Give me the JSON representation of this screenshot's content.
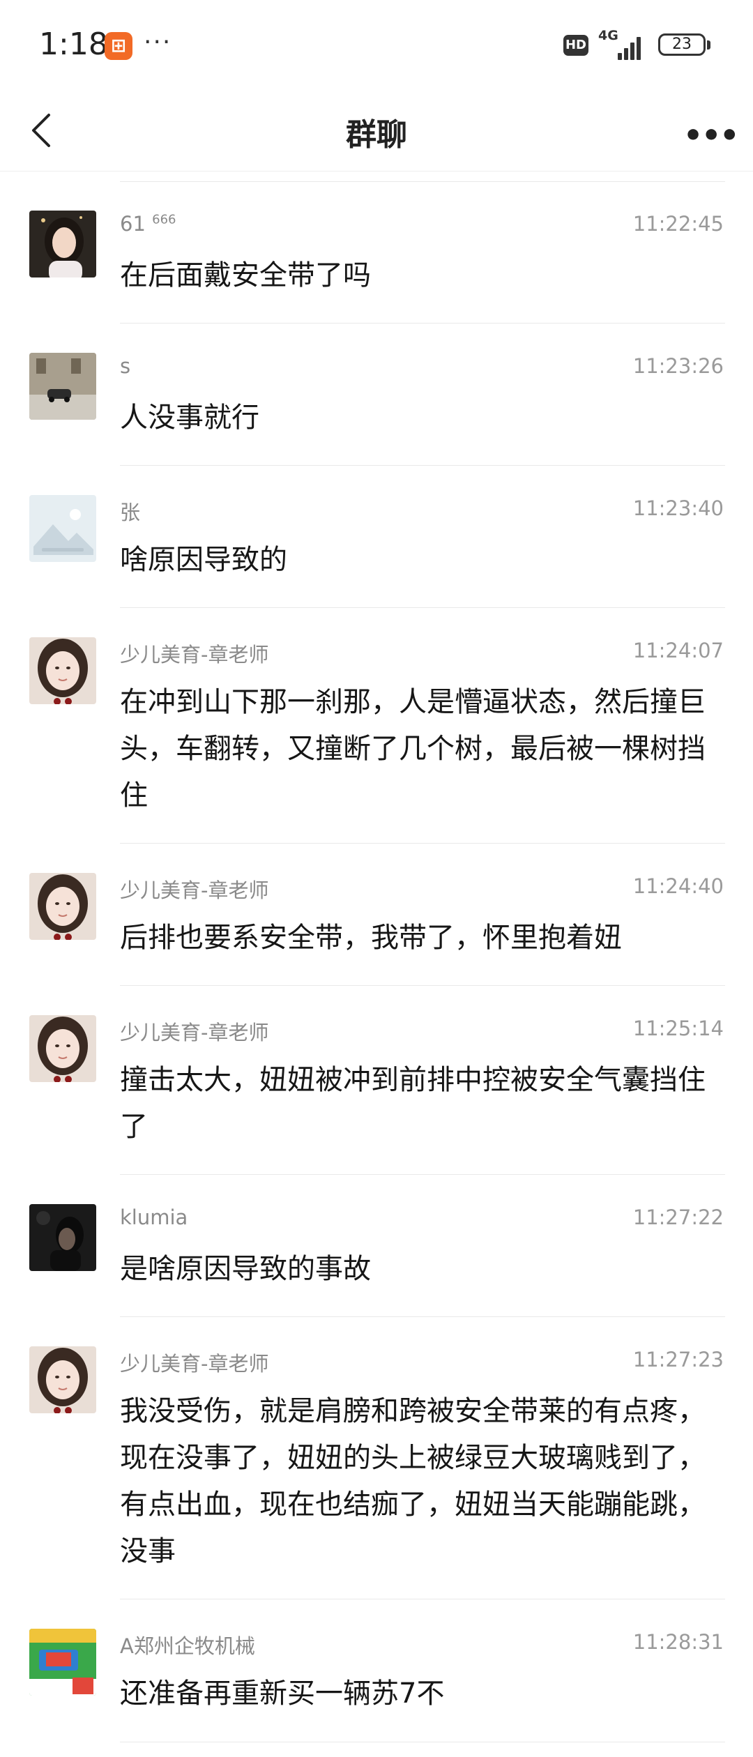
{
  "status_bar": {
    "time": "1:18",
    "app_icon": "app-badge-icon",
    "more": "···",
    "hd": "HD",
    "network": "4G",
    "battery": "23"
  },
  "header": {
    "title": "群聊",
    "back_icon": "back-chevron-icon",
    "more_icon": "more-dots-icon",
    "more_label": "•••"
  },
  "messages": [
    {
      "name": "61",
      "name_sup": "666",
      "time": "11:22:45",
      "text": "在后面戴安全带了吗",
      "avatar": "avatar-woman-portrait"
    },
    {
      "name": "s",
      "name_sup": "",
      "time": "11:23:26",
      "text": "人没事就行",
      "avatar": "avatar-car-street"
    },
    {
      "name": "张",
      "name_sup": "",
      "time": "11:23:40",
      "text": "啥原因导致的",
      "avatar": "avatar-placeholder-image"
    },
    {
      "name": "少儿美育-章老师",
      "name_sup": "",
      "time": "11:24:07",
      "text": "在冲到山下那一刹那，人是懵逼状态，然后撞巨头，车翻转，又撞断了几个树，最后被一棵树挡住",
      "avatar": "avatar-teacher"
    },
    {
      "name": "少儿美育-章老师",
      "name_sup": "",
      "time": "11:24:40",
      "text": "后排也要系安全带，我带了，怀里抱着妞",
      "avatar": "avatar-teacher"
    },
    {
      "name": "少儿美育-章老师",
      "name_sup": "",
      "time": "11:25:14",
      "text": "撞击太大，妞妞被冲到前排中控被安全气囊挡住了",
      "avatar": "avatar-teacher"
    },
    {
      "name": "klumia",
      "name_sup": "",
      "time": "11:27:22",
      "text": "是啥原因导致的事故",
      "avatar": "avatar-dark-portrait"
    },
    {
      "name": "少儿美育-章老师",
      "name_sup": "",
      "time": "11:27:23",
      "text": "我没受伤，就是肩膀和跨被安全带莱的有点疼，现在没事了，妞妞的头上被绿豆大玻璃贱到了，有点出血，现在也结痂了，妞妞当天能蹦能跳，没事",
      "avatar": "avatar-teacher"
    },
    {
      "name": "A郑州企牧机械",
      "name_sup": "",
      "time": "11:28:31",
      "text": "还准备再重新买一辆苏7不",
      "avatar": "avatar-machinery-ad"
    }
  ]
}
